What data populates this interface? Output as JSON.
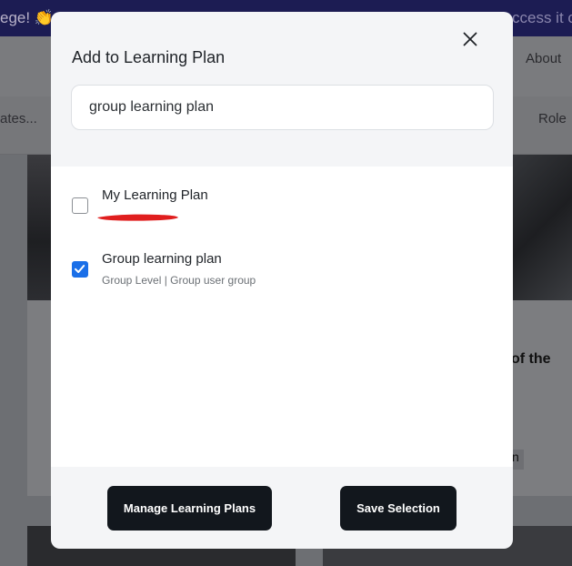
{
  "background": {
    "banner_left_text": "ege! 👏",
    "banner_right_text": "ccess it c",
    "nav_about": "About",
    "filter_left_text": "ates...",
    "filter_role": "Role",
    "card_heading_fragment": "of the",
    "card_link_fragment": "n"
  },
  "modal": {
    "title": "Add to Learning Plan",
    "search": {
      "value": "group learning plan",
      "placeholder": ""
    },
    "options": [
      {
        "label": "My Learning Plan",
        "sublabel": "",
        "checked": false
      },
      {
        "label": "Group learning plan",
        "sublabel": "Group Level | Group user group",
        "checked": true
      }
    ],
    "annotation_color": "#e01e1e",
    "manage_button": "Manage Learning Plans",
    "save_button": "Save Selection"
  },
  "colors": {
    "accent_checkbox": "#1a6fe8",
    "button_bg": "#12171d",
    "modal_bg": "#f4f5f7"
  }
}
